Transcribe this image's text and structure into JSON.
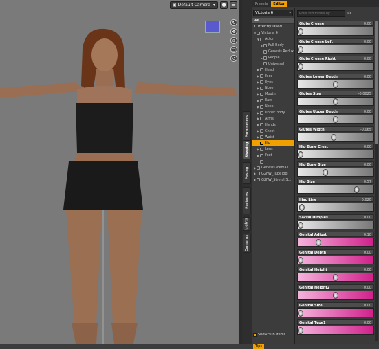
{
  "viewport": {
    "camera": "Default Camera"
  },
  "side_tabs": [
    "Parameters",
    "Shaping",
    "Posing",
    "Surfaces",
    "Lights",
    "Cameras"
  ],
  "side_tabs_active": "Shaping",
  "pane_tabs": [
    "Presets",
    "Editor"
  ],
  "pane_tabs_active": "Editor",
  "figure_select": "Victoria 6",
  "list_items": [
    "All",
    "Currently Used"
  ],
  "tree": [
    {
      "label": "Victoria 6",
      "indent": 0,
      "tw": "▼"
    },
    {
      "label": "Actor",
      "indent": 1,
      "tw": "▼"
    },
    {
      "label": "Full Body",
      "indent": 2,
      "tw": "▶"
    },
    {
      "label": "Genesis Redux",
      "indent": 2,
      "tw": ""
    },
    {
      "label": "People",
      "indent": 2,
      "tw": "▶"
    },
    {
      "label": "Universal",
      "indent": 2,
      "tw": ""
    },
    {
      "label": "Head",
      "indent": 1,
      "tw": "▶"
    },
    {
      "label": "Face",
      "indent": 1,
      "tw": "▶"
    },
    {
      "label": "Eyes",
      "indent": 1,
      "tw": "▶"
    },
    {
      "label": "Nose",
      "indent": 1,
      "tw": "▶"
    },
    {
      "label": "Mouth",
      "indent": 1,
      "tw": "▶"
    },
    {
      "label": "Ears",
      "indent": 1,
      "tw": "▶"
    },
    {
      "label": "Neck",
      "indent": 1,
      "tw": "▶"
    },
    {
      "label": "Upper Body",
      "indent": 1,
      "tw": "▶"
    },
    {
      "label": "Arms",
      "indent": 1,
      "tw": "▶"
    },
    {
      "label": "Hands",
      "indent": 1,
      "tw": "▶"
    },
    {
      "label": "Chest",
      "indent": 1,
      "tw": "▶"
    },
    {
      "label": "Waist",
      "indent": 1,
      "tw": "▶"
    },
    {
      "label": "Hip",
      "indent": 1,
      "tw": "▶",
      "highlight": true
    },
    {
      "label": "Legs",
      "indent": 1,
      "tw": "▶"
    },
    {
      "label": "Feet",
      "indent": 1,
      "tw": "▶"
    },
    {
      "label": "",
      "indent": 1,
      "tw": ""
    },
    {
      "label": "Genesis2Femal...",
      "indent": 0,
      "tw": "▶"
    },
    {
      "label": "G2FW_TubeTop",
      "indent": 0,
      "tw": "▶"
    },
    {
      "label": "G2FW_StretchS...",
      "indent": 0,
      "tw": "▶"
    }
  ],
  "show_sub_items": "Show Sub Items",
  "tips": "Tips",
  "filter_placeholder": "Enter text to filter by...",
  "sliders": [
    {
      "label": "Glute Crease",
      "value": "0.00",
      "pos": 0.0
    },
    {
      "label": "Glute Crease Left",
      "value": "0.00",
      "pos": 0.0
    },
    {
      "label": "Glute Crease Right",
      "value": "0.00",
      "pos": 0.0
    },
    {
      "label": "Glutes Lower Depth",
      "value": "0.00",
      "pos": 0.5
    },
    {
      "label": "Glutes Size",
      "value": "-0.0025",
      "pos": 0.5
    },
    {
      "label": "Glutes Upper Depth",
      "value": "0.00",
      "pos": 0.5
    },
    {
      "label": "Glutes Width",
      "value": "-0.065",
      "pos": 0.47
    },
    {
      "label": "Hip Bone Crest",
      "value": "0.00",
      "pos": 0.0
    },
    {
      "label": "Hip Bone Size",
      "value": "0.00",
      "pos": 0.35
    },
    {
      "label": "Hip Size",
      "value": "0.57",
      "pos": 0.8
    },
    {
      "label": "Iliac Line",
      "value": "0.020",
      "pos": 0.02
    },
    {
      "label": "Sacral Dimples",
      "value": "0.00",
      "pos": 0.0
    },
    {
      "label": "Genital Adjust",
      "value": "0.10",
      "pos": 0.25,
      "pink": true
    },
    {
      "label": "Genital Depth",
      "value": "0.00",
      "pos": 0.0,
      "pink": true
    },
    {
      "label": "Genital Height",
      "value": "0.00",
      "pos": 0.5,
      "pink": true
    },
    {
      "label": "Genital Height2",
      "value": "0.00",
      "pos": 0.5,
      "pink": true
    },
    {
      "label": "Genital Size",
      "value": "0.00",
      "pos": 0.0,
      "pink": true
    },
    {
      "label": "Genital Type1",
      "value": "0.00",
      "pos": 0.0,
      "pink": true
    }
  ]
}
